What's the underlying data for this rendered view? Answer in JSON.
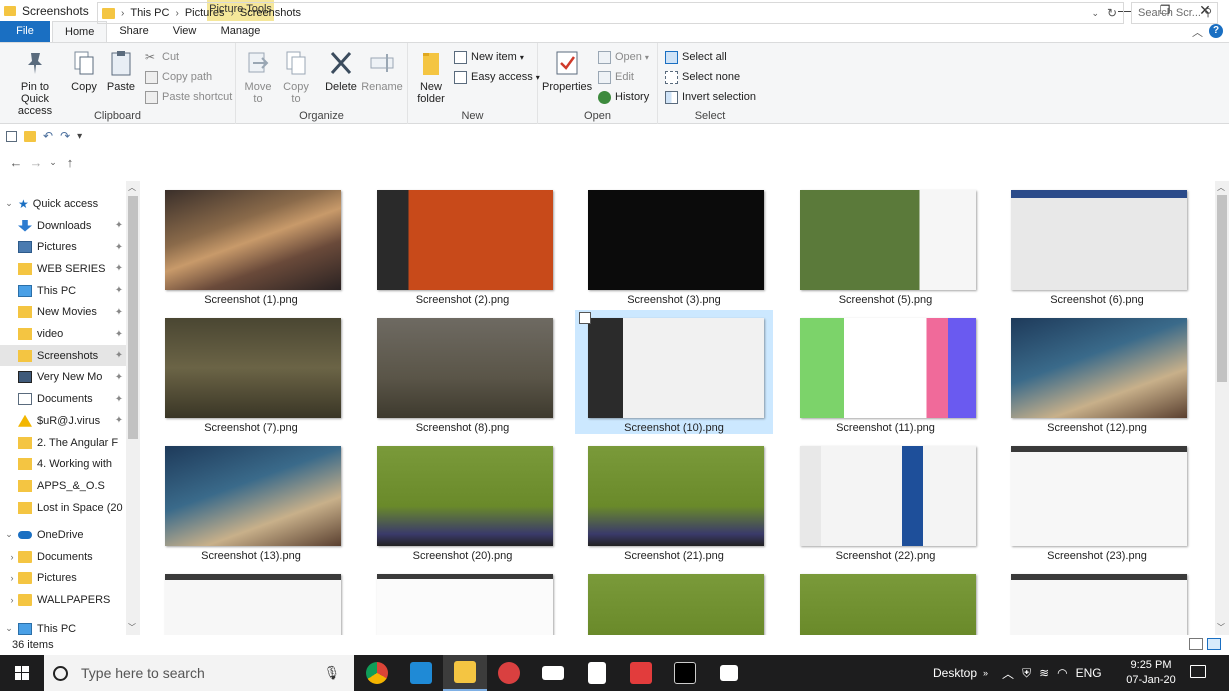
{
  "window": {
    "title": "Screenshots",
    "contextual_tab": "Picture Tools",
    "minimize": "—",
    "maximize": "❐",
    "close": "✕"
  },
  "ribbon_tabs": [
    "File",
    "Home",
    "Share",
    "View",
    "Manage"
  ],
  "ribbon": {
    "clipboard": {
      "label": "Clipboard",
      "pin": "Pin to Quick access",
      "copy": "Copy",
      "paste": "Paste",
      "cut": "Cut",
      "copy_path": "Copy path",
      "paste_shortcut": "Paste shortcut"
    },
    "organize": {
      "label": "Organize",
      "move_to": "Move to",
      "copy_to": "Copy to",
      "delete": "Delete",
      "rename": "Rename"
    },
    "new": {
      "label": "New",
      "new_folder": "New folder",
      "new_item": "New item",
      "easy_access": "Easy access"
    },
    "open": {
      "label": "Open",
      "properties": "Properties",
      "open": "Open",
      "edit": "Edit",
      "history": "History"
    },
    "select": {
      "label": "Select",
      "select_all": "Select all",
      "select_none": "Select none",
      "invert": "Invert selection"
    }
  },
  "address": {
    "crumbs": [
      "This PC",
      "Pictures",
      "Screenshots"
    ],
    "search_placeholder": "Search Scr..."
  },
  "nav": {
    "quick_access": "Quick access",
    "items": [
      {
        "label": "Downloads",
        "icon": "download-icon",
        "pinned": true
      },
      {
        "label": "Pictures",
        "icon": "pictures-icon",
        "pinned": true
      },
      {
        "label": "WEB SERIES",
        "icon": "folder-icon",
        "pinned": true
      },
      {
        "label": "This PC",
        "icon": "pc-icon",
        "pinned": true
      },
      {
        "label": "New Movies",
        "icon": "folder-icon",
        "pinned": true
      },
      {
        "label": "video",
        "icon": "folder-icon",
        "pinned": true
      },
      {
        "label": "Screenshots",
        "icon": "folder-icon",
        "pinned": true
      },
      {
        "label": "Very New Mo",
        "icon": "video-icon",
        "pinned": true
      },
      {
        "label": "Documents",
        "icon": "documents-icon",
        "pinned": true
      },
      {
        "label": "$uR@J.virus",
        "icon": "warning-icon",
        "pinned": true
      },
      {
        "label": "2. The Angular F",
        "icon": "folder-icon",
        "pinned": false
      },
      {
        "label": "4. Working with",
        "icon": "folder-icon",
        "pinned": false
      },
      {
        "label": "APPS_&_O.S",
        "icon": "folder-icon",
        "pinned": false
      },
      {
        "label": "Lost in Space (20",
        "icon": "folder-icon",
        "pinned": false
      }
    ],
    "onedrive": "OneDrive",
    "onedrive_items": [
      "Documents",
      "Pictures",
      "WALLPAPERS"
    ],
    "this_pc": "This PC"
  },
  "files": [
    {
      "name": "Screenshot (1).png",
      "theme": "racing"
    },
    {
      "name": "Screenshot (2).png",
      "theme": "startmenu"
    },
    {
      "name": "Screenshot (3).png",
      "theme": "dialog"
    },
    {
      "name": "Screenshot (5).png",
      "theme": "coc"
    },
    {
      "name": "Screenshot (6).png",
      "theme": "form"
    },
    {
      "name": "Screenshot (7).png",
      "theme": "pubg"
    },
    {
      "name": "Screenshot (8).png",
      "theme": "pubg2"
    },
    {
      "name": "Screenshot (10).png",
      "theme": "settings"
    },
    {
      "name": "Screenshot (11).png",
      "theme": "login"
    },
    {
      "name": "Screenshot (12).png",
      "theme": "desktop"
    },
    {
      "name": "Screenshot (13).png",
      "theme": "desktop"
    },
    {
      "name": "Screenshot (20).png",
      "theme": "coc2"
    },
    {
      "name": "Screenshot (21).png",
      "theme": "coc2"
    },
    {
      "name": "Screenshot (22).png",
      "theme": "web"
    },
    {
      "name": "Screenshot (23).png",
      "theme": "white"
    },
    {
      "name": "",
      "theme": "white"
    },
    {
      "name": "",
      "theme": "blank"
    },
    {
      "name": "",
      "theme": "coc2"
    },
    {
      "name": "",
      "theme": "coc2"
    },
    {
      "name": "",
      "theme": "white"
    }
  ],
  "status": {
    "count": "36 items"
  },
  "taskbar": {
    "search_placeholder": "Type here to search",
    "desktop": "Desktop",
    "lang": "ENG",
    "time": "9:25 PM",
    "date": "07-Jan-20"
  }
}
